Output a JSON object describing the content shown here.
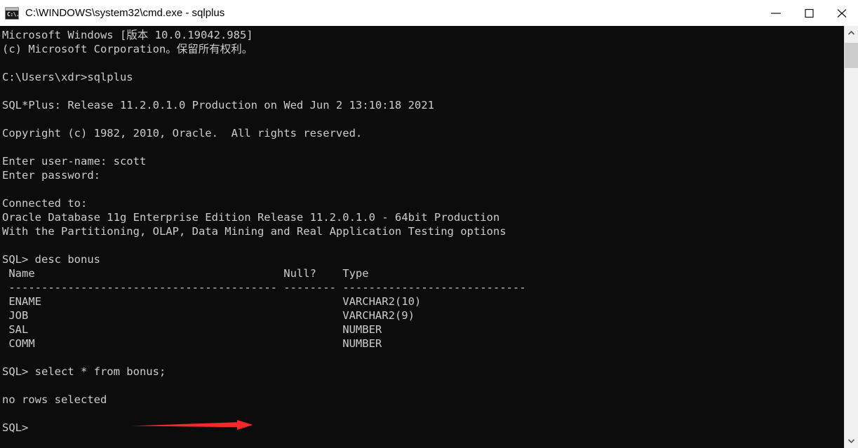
{
  "window": {
    "title": "C:\\WINDOWS\\system32\\cmd.exe - sqlplus",
    "app_icon": "cmd-console-icon",
    "icon_glyph": "C:\\.",
    "background_color": "#0c0c0c",
    "text_color": "#cccccc",
    "titlebar_color": "#ffffff"
  },
  "window_controls": {
    "minimize_label": "Minimize",
    "maximize_label": "Maximize",
    "close_label": "Close"
  },
  "terminal": {
    "content": "Microsoft Windows [版本 10.0.19042.985]\n(c) Microsoft Corporation。保留所有权利。\n\nC:\\Users\\xdr>sqlplus\n\nSQL*Plus: Release 11.2.0.1.0 Production on Wed Jun 2 13:10:18 2021\n\nCopyright (c) 1982, 2010, Oracle.  All rights reserved.\n\nEnter user-name: scott\nEnter password:\n\nConnected to:\nOracle Database 11g Enterprise Edition Release 11.2.0.1.0 - 64bit Production\nWith the Partitioning, OLAP, Data Mining and Real Application Testing options\n\nSQL> desc bonus\n Name                                      Null?    Type\n ----------------------------------------- -------- ----------------------------\n ENAME                                              VARCHAR2(10)\n JOB                                                VARCHAR2(9)\n SAL                                                NUMBER\n COMM                                               NUMBER\n\nSQL> select * from bonus;\n\nno rows selected\n\nSQL>",
    "lines": [
      "Microsoft Windows [版本 10.0.19042.985]",
      "(c) Microsoft Corporation。保留所有权利。",
      "",
      "C:\\Users\\xdr>sqlplus",
      "",
      "SQL*Plus: Release 11.2.0.1.0 Production on Wed Jun 2 13:10:18 2021",
      "",
      "Copyright (c) 1982, 2010, Oracle.  All rights reserved.",
      "",
      "Enter user-name: scott",
      "Enter password:",
      "",
      "Connected to:",
      "Oracle Database 11g Enterprise Edition Release 11.2.0.1.0 - 64bit Production",
      "With the Partitioning, OLAP, Data Mining and Real Application Testing options",
      "",
      "SQL> desc bonus",
      " Name                                      Null?    Type",
      " ----------------------------------------- -------- ----------------------------",
      " ENAME                                              VARCHAR2(10)",
      " JOB                                                VARCHAR2(9)",
      " SAL                                                NUMBER",
      " COMM                                               NUMBER",
      "",
      "SQL> select * from bonus;",
      "",
      "no rows selected",
      "",
      "SQL>"
    ],
    "prompt": "SQL>",
    "commands": [
      "sqlplus",
      "desc bonus",
      "select * from bonus;"
    ],
    "desc_table": {
      "headers": [
        "Name",
        "Null?",
        "Type"
      ],
      "rows": [
        [
          "ENAME",
          "",
          "VARCHAR2(10)"
        ],
        [
          "JOB",
          "",
          "VARCHAR2(9)"
        ],
        [
          "SAL",
          "",
          "NUMBER"
        ],
        [
          "COMM",
          "",
          "NUMBER"
        ]
      ]
    },
    "query_result": "no rows selected",
    "cursor_visible": true
  },
  "annotation": {
    "type": "arrow",
    "direction": "right",
    "color": "#f42a2a",
    "points_at": "no rows selected"
  },
  "scrollbar": {
    "up_arrow": "chevron-up-icon",
    "down_arrow": "chevron-down-icon",
    "thumb_color": "#cdcdcd",
    "track_color": "#f0f0f0"
  }
}
